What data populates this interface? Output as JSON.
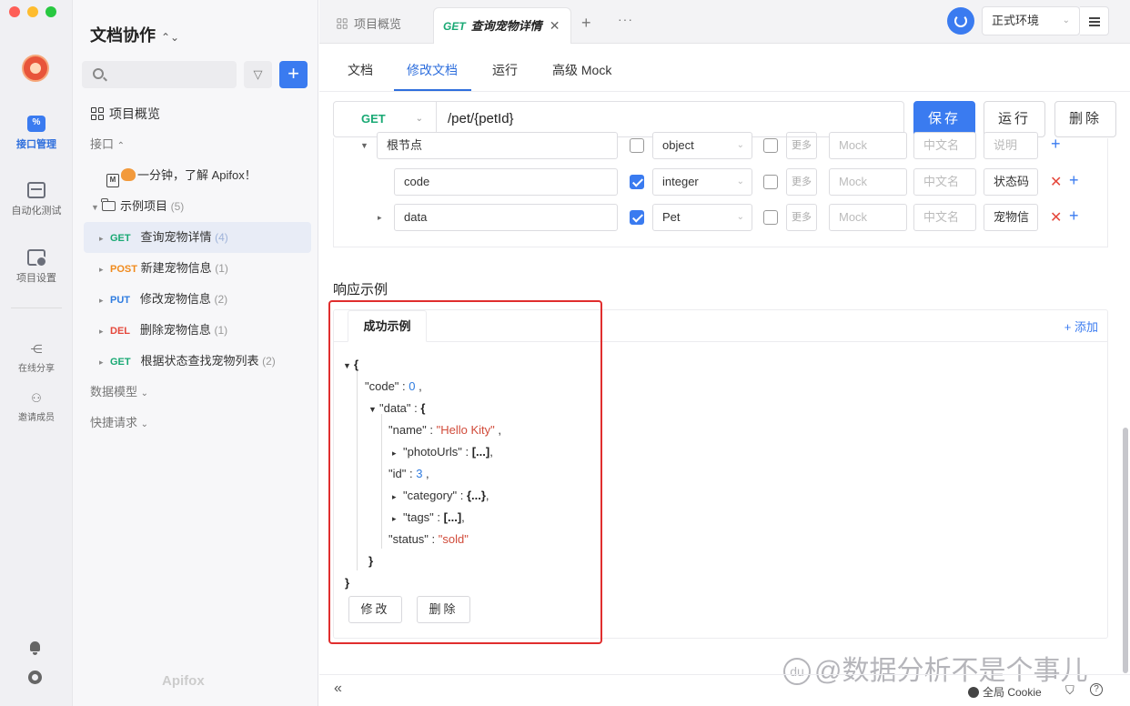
{
  "rail": {
    "items": [
      {
        "label": "接口管理",
        "icon": "api-icon"
      },
      {
        "label": "自动化测试",
        "icon": "automation-icon"
      },
      {
        "label": "项目设置",
        "icon": "settings-icon"
      },
      {
        "label": "在线分享",
        "icon": "share-icon"
      },
      {
        "label": "邀请成员",
        "icon": "invite-icon"
      }
    ]
  },
  "sidebar": {
    "project_title": "文档协作",
    "overview": "项目概览",
    "api_section": "接口",
    "intro_item": "一分钟，了解 Apifox！",
    "folder": {
      "name": "示例项目",
      "count": "(5)"
    },
    "endpoints": [
      {
        "method": "GET",
        "name": "查询宠物详情",
        "count": "(4)"
      },
      {
        "method": "POST",
        "name": "新建宠物信息",
        "count": "(1)"
      },
      {
        "method": "PUT",
        "name": "修改宠物信息",
        "count": "(2)"
      },
      {
        "method": "DEL",
        "name": "删除宠物信息",
        "count": "(1)"
      },
      {
        "method": "GET",
        "name": "根据状态查找宠物列表",
        "count": "(2)"
      }
    ],
    "data_models": "数据模型",
    "quick_requests": "快捷请求",
    "brand": "Apifox"
  },
  "tabs": {
    "overview": "项目概览",
    "active_method": "GET",
    "active_title": "查询宠物详情"
  },
  "env": {
    "label": "正式环境"
  },
  "subtabs": [
    "文档",
    "修改文档",
    "运行",
    "高级 Mock"
  ],
  "request": {
    "method": "GET",
    "path": "/pet/{petId}",
    "save": "保存",
    "run": "运行",
    "delete": "删除"
  },
  "schema": {
    "rows": [
      {
        "name": "根节点",
        "type": "object",
        "more": "更多",
        "mock": "Mock",
        "cn": "中文名",
        "desc": "说明"
      },
      {
        "name": "code",
        "type": "integer",
        "more": "更多",
        "mock": "Mock",
        "cn": "中文名",
        "desc": "状态码"
      },
      {
        "name": "data",
        "type": "Pet",
        "more": "更多",
        "mock": "Mock",
        "cn": "中文名",
        "desc": "宠物信"
      }
    ]
  },
  "response": {
    "title": "响应示例",
    "tab": "成功示例",
    "add": "+ 添加",
    "edit": "修改",
    "delete": "删除",
    "json": {
      "open": "{",
      "code_key": "\"code\"",
      "code_val": "0",
      "data_key": "\"data\"",
      "name_key": "\"name\"",
      "name_val": "\"Hello Kity\"",
      "photo_key": "\"photoUrls\"",
      "photo_val": "[...]",
      "id_key": "\"id\"",
      "id_val": "3",
      "category_key": "\"category\"",
      "category_val": "{...}",
      "tags_key": "\"tags\"",
      "tags_val": "[...]",
      "status_key": "\"status\"",
      "status_val": "\"sold\"",
      "close_inner": "}",
      "close_outer": "}"
    }
  },
  "footer": {
    "cookie": "全局 Cookie",
    "watermark": "@数据分析不是个事儿",
    "watermark_logo": "du"
  },
  "colors": {
    "accent": "#3a7bf0",
    "get": "#19a974",
    "post": "#f08a1c",
    "put": "#2f7ce0",
    "del": "#e5483c",
    "highlight": "#e02e2e"
  }
}
